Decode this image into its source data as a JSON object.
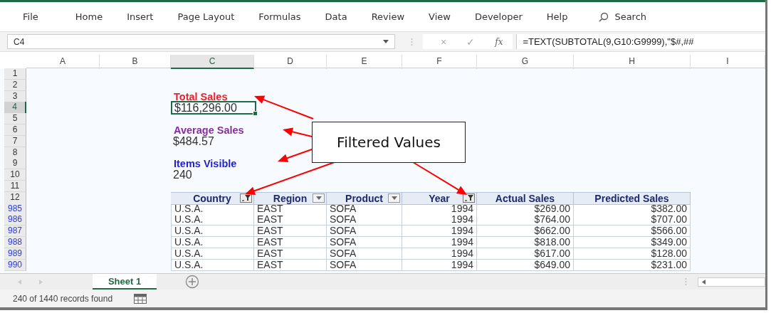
{
  "menu": [
    {
      "label": "File"
    },
    {
      "label": "Home"
    },
    {
      "label": "Insert"
    },
    {
      "label": "Page Layout"
    },
    {
      "label": "Formulas"
    },
    {
      "label": "Data"
    },
    {
      "label": "Review"
    },
    {
      "label": "View"
    },
    {
      "label": "Developer"
    },
    {
      "label": "Help"
    }
  ],
  "search": {
    "label": "Search"
  },
  "formula_bar": {
    "name_box": "C4",
    "cancel": "×",
    "enter": "✓",
    "function": "fx",
    "formula": "=TEXT(SUBTOTAL(9,G10:G9999),\"$#,##"
  },
  "columns": [
    {
      "label": "A",
      "selected": false
    },
    {
      "label": "B",
      "selected": false
    },
    {
      "label": "C",
      "selected": true
    },
    {
      "label": "D",
      "selected": false
    },
    {
      "label": "E",
      "selected": false
    },
    {
      "label": "F",
      "selected": false
    },
    {
      "label": "G",
      "selected": false
    },
    {
      "label": "H",
      "selected": false
    },
    {
      "label": "I",
      "selected": false
    }
  ],
  "rows": [
    {
      "number": "1",
      "kind": "blank",
      "selected": false,
      "filtered": false
    },
    {
      "number": "2",
      "kind": "blank",
      "selected": false,
      "filtered": false
    },
    {
      "number": "3",
      "kind": "label",
      "text": "Total Sales",
      "color": "#e8202a",
      "selected": false,
      "filtered": false
    },
    {
      "number": "4",
      "kind": "value",
      "text": "$116,296.00",
      "selected": true,
      "filtered": false
    },
    {
      "number": "5",
      "kind": "blank",
      "selected": false,
      "filtered": false
    },
    {
      "number": "6",
      "kind": "label",
      "text": "Average Sales",
      "color": "#8b2c9e",
      "selected": false,
      "filtered": false
    },
    {
      "number": "7",
      "kind": "value",
      "text": "$484.57",
      "selected": false,
      "filtered": false
    },
    {
      "number": "8",
      "kind": "blank",
      "selected": false,
      "filtered": false
    },
    {
      "number": "9",
      "kind": "label",
      "text": "Items Visible",
      "color": "#1f1fd0",
      "selected": false,
      "filtered": false
    },
    {
      "number": "10",
      "kind": "value",
      "text": "240",
      "selected": false,
      "filtered": false
    },
    {
      "number": "11",
      "kind": "blank",
      "selected": false,
      "filtered": false
    },
    {
      "number": "12",
      "kind": "header",
      "selected": false,
      "filtered": false
    },
    {
      "number": "985",
      "kind": "data",
      "cells": [
        "U.S.A.",
        "EAST",
        "SOFA",
        "1994",
        "$269.00",
        "$382.00"
      ],
      "selected": false,
      "filtered": true
    },
    {
      "number": "986",
      "kind": "data",
      "cells": [
        "U.S.A.",
        "EAST",
        "SOFA",
        "1994",
        "$764.00",
        "$707.00"
      ],
      "selected": false,
      "filtered": true
    },
    {
      "number": "987",
      "kind": "data",
      "cells": [
        "U.S.A.",
        "EAST",
        "SOFA",
        "1994",
        "$662.00",
        "$566.00"
      ],
      "selected": false,
      "filtered": true
    },
    {
      "number": "988",
      "kind": "data",
      "cells": [
        "U.S.A.",
        "EAST",
        "SOFA",
        "1994",
        "$818.00",
        "$349.00"
      ],
      "selected": false,
      "filtered": true
    },
    {
      "number": "989",
      "kind": "data",
      "cells": [
        "U.S.A.",
        "EAST",
        "SOFA",
        "1994",
        "$617.00",
        "$128.00"
      ],
      "selected": false,
      "filtered": true
    },
    {
      "number": "990",
      "kind": "data",
      "cells": [
        "U.S.A.",
        "EAST",
        "SOFA",
        "1994",
        "$649.00",
        "$231.00"
      ],
      "selected": false,
      "filtered": true
    }
  ],
  "table_columns": [
    {
      "label": "Country",
      "kind": "text",
      "filter_button": true,
      "filter_applied": true
    },
    {
      "label": "Region",
      "kind": "text",
      "filter_button": true,
      "filter_applied": false
    },
    {
      "label": "Product",
      "kind": "text",
      "filter_button": true,
      "filter_applied": false
    },
    {
      "label": "Year",
      "kind": "number",
      "filter_button": true,
      "filter_applied": true
    },
    {
      "label": "Actual Sales",
      "kind": "number",
      "filter_button": false
    },
    {
      "label": "Predicted Sales",
      "kind": "number",
      "filter_button": false
    }
  ],
  "sheet_tabs": [
    {
      "label": "Sheet 1",
      "selected": true
    }
  ],
  "status_bar": {
    "text": "240 of 1440 records found"
  },
  "callout": {
    "text": "Filtered Values"
  }
}
